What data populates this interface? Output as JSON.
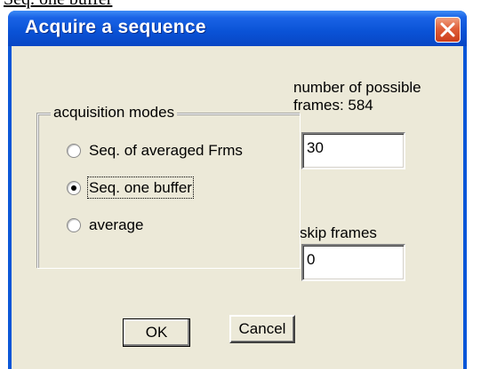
{
  "background_text": "Seq. one buffer",
  "dialog": {
    "title": "Acquire a sequence",
    "close_symbol": "×"
  },
  "frames": {
    "label_line1": "number of possible",
    "label_line2": "frames: 584",
    "input_value": "30"
  },
  "skip": {
    "label": "skip frames",
    "input_value": "0"
  },
  "acquisition_modes": {
    "legend": "acquisition modes",
    "options": [
      {
        "label": "Seq. of averaged Frms",
        "checked": false
      },
      {
        "label": "Seq. one buffer",
        "checked": true
      },
      {
        "label": "average",
        "checked": false
      }
    ]
  },
  "buttons": {
    "ok_label": "OK",
    "cancel_label": "Cancel"
  },
  "colors": {
    "titlebar": "#0a52d6",
    "client": "#ece9d8",
    "close_button": "#e0603a"
  }
}
